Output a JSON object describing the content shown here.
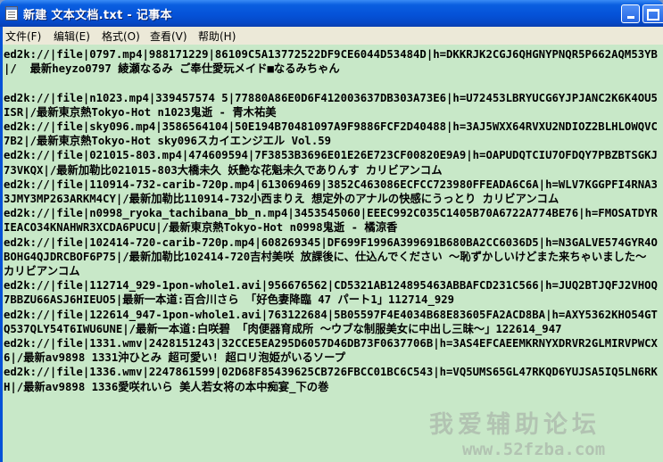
{
  "window": {
    "title": "新建 文本文档.txt - 记事本",
    "app_icon": "notepad-icon"
  },
  "menu": [
    {
      "label": "文件(F)"
    },
    {
      "label": "编辑(E)"
    },
    {
      "label": "格式(O)"
    },
    {
      "label": "查看(V)"
    },
    {
      "label": "帮助(H)"
    }
  ],
  "editor": {
    "text": "ed2k://|file|0797.mp4|988171229|86109C5A13772522DF9CE6044D53484D|h=DKKRJK2CGJ6QHGNYPNQR5P662AQM53YB|/  最新heyzo0797 綾瀬なるみ ご奉仕愛玩メイド■なるみちゃん\n\ned2k://|file|n1023.mp4|339457574 5|77880A86E0D6F412003637DB303A73E6|h=U72453LBRYUCG6YJPJANC2K6K4OU5ISR|/最新東京熱Tokyo-Hot n1023鬼逝 - 青木祐美\ned2k://|file|sky096.mp4|3586564104|50E194B70481097A9F9886FCF2D40488|h=3AJ5WXX64RVXU2NDIOZ2BLHLOWQVC7B2|/最新東京熱Tokyo-Hot sky096スカイエンジエル Vol.59\ned2k://|file|021015-803.mp4|474609594|7F3853B3696E01E26E723CF00820E9A9|h=OAPUDQTCIU7OFDQY7PBZBTSGKJ73VKQX|/最新加勒比021015-803大橋未久 妖艶な花魁未久でありんす カリビアンコム\ned2k://|file|110914-732-carib-720p.mp4|613069469|3852C463086ECFCC723980FFEADA6C6A|h=WLV7KGGPFI4RNA33JMY3MP263ARKM4CY|/最新加勒比110914-732小西まりえ 想定外のアナルの快感にうっとり カリビアンコム\ned2k://|file|n0998_ryoka_tachibana_bb_n.mp4|3453545060|EEEC992C035C1405B70A6722A774BE76|h=FMOSATDYRIEACO34KNAHWR3XCDA6PUCU|/最新東京熱Tokyo-Hot n0998鬼逝 - 橘涼香\ned2k://|file|102414-720-carib-720p.mp4|608269345|DF699F1996A399691B680BA2CC6036D5|h=N3GALVE574GYR4OBOHG4QJDRCBOF6P75|/最新加勒比102414-720吉村美咲 放課後に、仕込んでください ～恥ずかしいけどまた来ちゃいました～ カリビアンコム\ned2k://|file|112714_929-1pon-whole1.avi|956676562|CD5321AB124895463ABBAFCD231C566|h=JUQ2BTJQFJ2VHOQ7BBZU66ASJ6HIEUO5|最新一本道:百合川さら 「好色妻降臨 47 パート1」112714_929\ned2k://|file|122614_947-1pon-whole1.avi|763122684|5B05597F4E4034B68E83605FA2ACD8BA|h=AXY5362KHO54GTQ537QLY54T6IWU6UNE|/最新一本道:白咲碧 「肉便器育成所 ～ウブな制服美女に中出し三昧～」122614_947\ned2k://|file|1331.wmv|2428151243|32CCE5EA295D6057D46DB73F0637706B|h=3AS4EFCAEEMKRNYXDRVR2GLMIRVPWCX6|/最新av9898 1331沖ひとみ 超可愛い! 超ロリ泡姫がいるソープ\ned2k://|file|1336.wmv|2247861599|02D68F85439625CB726FBCC01BC6C543|h=VQ5UMS65GL47RKQD6YUJSA5IQ5LN6RKH|/最新av9898 1336愛咲れいら 美人若女将の本中痴宴_下の巻"
  },
  "watermark": {
    "line1": "我爱辅助论坛",
    "line2": "www.52fzba.com"
  },
  "colors": {
    "titlebar": "#0552d8",
    "menubar": "#ece9d8",
    "editor_bg": "#c8e8c8"
  }
}
